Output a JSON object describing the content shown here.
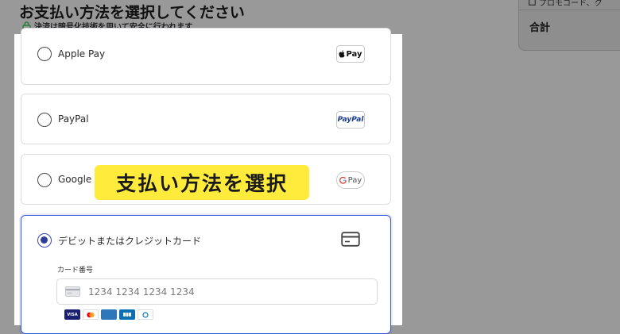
{
  "header": {
    "title": "お支払い方法を選択してください",
    "secure_note": "決済は暗号化技術を用いて安全に行われます"
  },
  "summary": {
    "promo": "プロモコード、ク",
    "total_label": "合計"
  },
  "payment_methods": [
    {
      "label": "Apple Pay",
      "badge": "Pay",
      "selected": false,
      "icon": "apple-pay-logo"
    },
    {
      "label": "PayPal",
      "badge": "PayPal",
      "selected": false,
      "icon": "paypal-logo"
    },
    {
      "label": "Google Pay",
      "badge": "Pay",
      "selected": false,
      "icon": "google-pay-logo"
    },
    {
      "label": "デビットまたはクレジットカード",
      "selected": true,
      "icon": "credit-card-icon"
    }
  ],
  "card_form": {
    "card_number_label": "カード番号",
    "card_number_placeholder": "1234 1234 1234 1234",
    "brands": [
      {
        "name": "VISA",
        "color": "#1a1f71"
      },
      {
        "name": "Mastercard",
        "color": "#eb001b"
      },
      {
        "name": "AMEX",
        "color": "#2e77bb"
      },
      {
        "name": "JCB",
        "color": "#0b6fb3"
      },
      {
        "name": "Diners",
        "color": "#0079be"
      }
    ]
  },
  "overlay": {
    "text": "支払い方法を選択"
  },
  "colors": {
    "accent": "#3a5bd9",
    "highlight": "#ffeb3b"
  }
}
